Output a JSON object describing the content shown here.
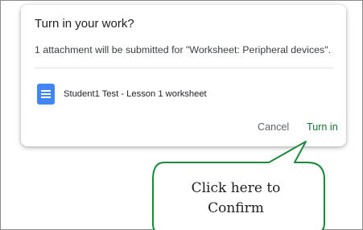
{
  "dialog": {
    "title": "Turn in your work?",
    "subtitle": "1 attachment will be submitted for \"Worksheet: Peripheral devices\".",
    "attachment": {
      "icon": "google-docs-icon",
      "name": "Student1 Test - Lesson 1 worksheet"
    },
    "buttons": {
      "cancel_label": "Cancel",
      "turn_in_label": "Turn in"
    }
  },
  "callout": {
    "text": "Click here to\nConfirm",
    "border_color": "#1a8a3a"
  },
  "colors": {
    "doc_icon": "#4285f4",
    "turn_in_text": "#137333"
  }
}
